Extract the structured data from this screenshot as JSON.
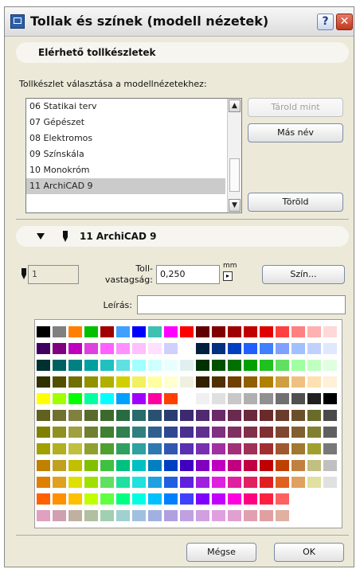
{
  "window": {
    "title": "Tollak és színek (modell nézetek)",
    "help_label": "?",
    "close_label": "✕"
  },
  "sets_section": {
    "heading": "Elérhető tollkészletek",
    "choose_label": "Tollkészlet választása a modellnézetekhez:",
    "items": [
      {
        "label": "06 Statikai terv",
        "selected": false
      },
      {
        "label": "07 Gépészet",
        "selected": false
      },
      {
        "label": "08 Elektromos",
        "selected": false
      },
      {
        "label": "09 Színskála",
        "selected": false
      },
      {
        "label": "10 Monokróm",
        "selected": false
      },
      {
        "label": "11 ArchiCAD 9",
        "selected": true
      }
    ],
    "buttons": {
      "store_as": "Tárold mint",
      "rename": "Más név",
      "delete": "Töröld"
    }
  },
  "pen_section": {
    "heading": "11 ArchiCAD 9",
    "pen_number": "1",
    "thickness_label_1": "Toll-",
    "thickness_label_2": "vastagság:",
    "thickness_value": "0,250",
    "unit": "mm",
    "color_button": "Szín...",
    "description_label": "Leírás:",
    "description_value": ""
  },
  "palette": {
    "rows": [
      [
        "#000000",
        "#808080",
        "#ff8000",
        "#00c000",
        "#a00000",
        "#40a0ff",
        "#0000ff",
        "#40c0b0",
        "#ff00ff",
        "#ff0000",
        "#600000",
        "#800000",
        "#a00000",
        "#c00000",
        "#e00000",
        "#ff4040",
        "#ff8080",
        "#ffb0b0",
        "#ffd8d8"
      ],
      [
        "#400060",
        "#800080",
        "#c000c0",
        "#e040e0",
        "#ff60ff",
        "#ff90ff",
        "#ffc0ff",
        "#ffe0ff",
        "#d0d0ff",
        "#ffffff",
        "#002040",
        "#003080",
        "#0040c0",
        "#2060ff",
        "#4080ff",
        "#80a0ff",
        "#a0c0ff",
        "#c0d0ff",
        "#e0e8ff"
      ],
      [
        "#003030",
        "#006060",
        "#008080",
        "#00a0a0",
        "#20c0c0",
        "#60e0e0",
        "#a0ffff",
        "#d0ffff",
        "#e8ffff",
        "#e0f0f0",
        "#003000",
        "#005000",
        "#007000",
        "#00a000",
        "#20c020",
        "#60e060",
        "#a0ffa0",
        "#c0ffc0",
        "#e0ffe0"
      ],
      [
        "#303000",
        "#505000",
        "#707000",
        "#909000",
        "#b0b000",
        "#d0d000",
        "#f0f060",
        "#ffffa0",
        "#ffffd0",
        "#f0f0e0",
        "#302000",
        "#503000",
        "#704000",
        "#906000",
        "#b08000",
        "#d0a040",
        "#f0c080",
        "#ffe0b0",
        "#fff0d8"
      ],
      [
        "#ffff00",
        "#a0ff00",
        "#00ff00",
        "#00ffa0",
        "#00ffff",
        "#00a0ff",
        "#a000ff",
        "#ff00a0",
        "#ff4000",
        "#ffffff",
        "#f0f0f0",
        "#e0e0e0",
        "#c8c8c8",
        "#b0b0b0",
        "#909090",
        "#707070",
        "#505050",
        "#202020",
        "#000000"
      ],
      [
        "#606020",
        "#707030",
        "#808040",
        "#5a6a2a",
        "#3c6a2c",
        "#2a6a40",
        "#2a6a6a",
        "#2a5070",
        "#2a3c70",
        "#3c2a70",
        "#502a70",
        "#6a2a6a",
        "#6a2a50",
        "#6a2a3c",
        "#6a2a2a",
        "#6a3c2a",
        "#6a502a",
        "#6a6a2a",
        "#4a4a4a"
      ],
      [
        "#808000",
        "#909020",
        "#a0a040",
        "#708030",
        "#408030",
        "#308050",
        "#308080",
        "#306090",
        "#304890",
        "#483090",
        "#603090",
        "#803080",
        "#803060",
        "#803048",
        "#803030",
        "#804830",
        "#806030",
        "#808030",
        "#606060"
      ],
      [
        "#a0a000",
        "#b0b020",
        "#c0c040",
        "#90a030",
        "#50a030",
        "#30a060",
        "#30a0a0",
        "#3078b0",
        "#3058b0",
        "#5830b0",
        "#7830b0",
        "#a030a0",
        "#a03078",
        "#a03058",
        "#a03030",
        "#a05830",
        "#a07830",
        "#a0a030",
        "#787878"
      ],
      [
        "#c08000",
        "#c0a020",
        "#c0c000",
        "#80c000",
        "#40c040",
        "#00c080",
        "#00c0c0",
        "#0080c0",
        "#0040c0",
        "#4000c0",
        "#8000c0",
        "#c000c0",
        "#c00080",
        "#c00040",
        "#c00000",
        "#c04000",
        "#c08040",
        "#c0c080",
        "#c0c0c0"
      ],
      [
        "#e08000",
        "#e0a020",
        "#e0e000",
        "#a0e000",
        "#60e060",
        "#20e0a0",
        "#20e0e0",
        "#20a0e0",
        "#2060e0",
        "#6020e0",
        "#a020e0",
        "#e020e0",
        "#e020a0",
        "#e02060",
        "#e02020",
        "#e06020",
        "#e0a060",
        "#e0e0a0",
        "#e0e0e0"
      ],
      [
        "#ff6000",
        "#ff9000",
        "#ffc000",
        "#c0ff00",
        "#60ff40",
        "#00ff80",
        "#00ffe0",
        "#00c0ff",
        "#0080ff",
        "#4040ff",
        "#8000ff",
        "#c000ff",
        "#ff00e0",
        "#ff0080",
        "#ff2040",
        "#ff6060"
      ],
      [
        "#e0a0c0",
        "#d0a0b0",
        "#c0b0a0",
        "#b0c0a0",
        "#a0d0b0",
        "#a0d0d0",
        "#a0c0e0",
        "#a0b0e0",
        "#b0a0e0",
        "#c0a0e0",
        "#d0a0e0",
        "#e0a0e0",
        "#e0a0d0",
        "#e0a0b0",
        "#e0a0a0",
        "#e0b0a0"
      ]
    ]
  },
  "footer": {
    "cancel": "Mégse",
    "ok": "OK"
  }
}
